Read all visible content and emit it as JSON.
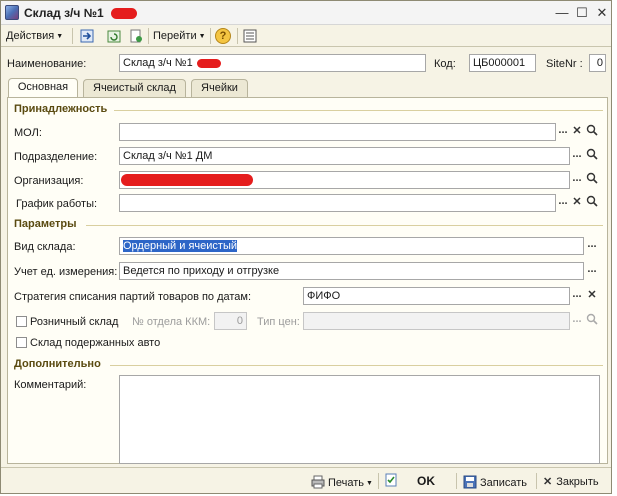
{
  "window": {
    "title": "Склад з/ч №1",
    "controls": {
      "minimize": "—",
      "maximize": "☐",
      "close": "✕"
    }
  },
  "toolbar": {
    "actions_label": "Действия",
    "goto_label": "Перейти",
    "help_label": "?"
  },
  "header": {
    "name_label": "Наименование:",
    "name_value": "Склад з/ч №1",
    "code_label": "Код:",
    "code_value": "ЦБ000001",
    "sitenr_label": "SiteNr :",
    "sitenr_value": "0"
  },
  "tabs": [
    {
      "label": "Основная",
      "active": true
    },
    {
      "label": "Ячеистый склад",
      "active": false
    },
    {
      "label": "Ячейки",
      "active": false
    }
  ],
  "main": {
    "section_belonging": "Принадлежность",
    "mol_label": "МОЛ:",
    "mol_value": "",
    "division_label": "Подразделение:",
    "division_value": "Склад з/ч №1 ДМ",
    "organization_label": "Организация:",
    "organization_value": "",
    "schedule_label": "График работы:",
    "schedule_value": "",
    "section_parameters": "Параметры",
    "warehouse_type_label": "Вид склада:",
    "warehouse_type_value": "Ордерный и ячеистый",
    "units_label": "Учет ед. измерения:",
    "units_value": "Ведется по приходу и отгрузке",
    "strategy_label": "Стратегия списания партий товаров по датам:",
    "strategy_value": "ФИФО",
    "retail_label": "Розничный склад",
    "kkm_label": "№ отдела ККМ:",
    "kkm_value": "0",
    "price_type_label": "Тип цен:",
    "price_type_value": "",
    "used_cars_label": "Склад подержанных авто",
    "section_additional": "Дополнительно",
    "comment_label": "Комментарий:",
    "comment_value": ""
  },
  "buttons": {
    "ellipsis": "...",
    "clear": "✕",
    "search": "🔍"
  },
  "footer": {
    "print_label": "Печать",
    "ok_label": "OK",
    "save_label": "Записать",
    "close_label": "Закрыть"
  },
  "colors": {
    "background": "#f6f3e5",
    "section_text": "#5a4a10",
    "selection": "#2d66c7",
    "redaction": "#e51d1d"
  }
}
